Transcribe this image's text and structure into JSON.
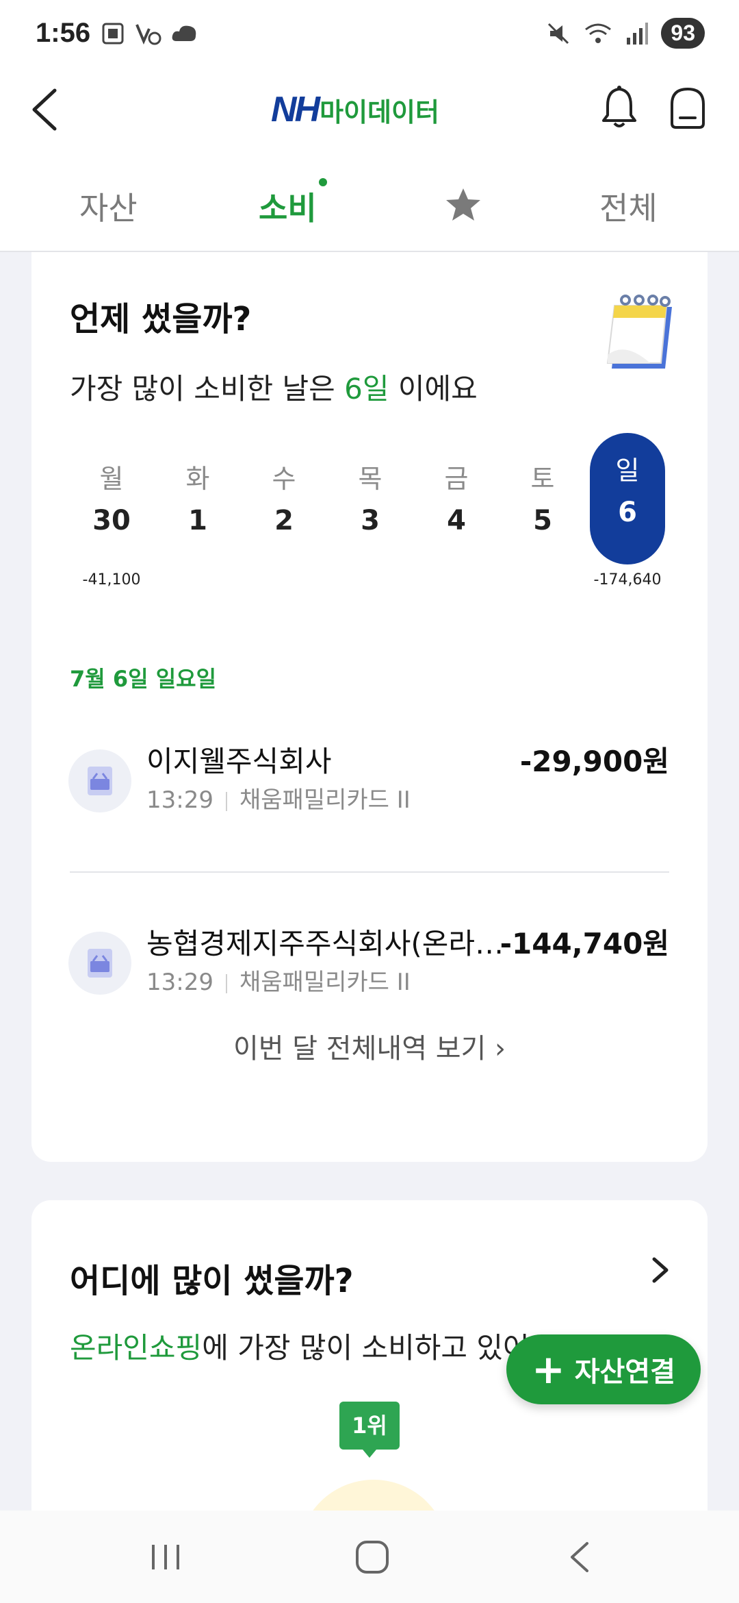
{
  "status_bar": {
    "time": "1:56",
    "battery": "93",
    "left_icons": [
      "screenshot-icon",
      "no-call-icon",
      "cloud-icon"
    ],
    "right_icons": [
      "mute-icon",
      "wifi-icon",
      "signal-icon"
    ]
  },
  "header": {
    "logo_brand": "NH",
    "logo_text": "마이데이터",
    "icons": [
      "back-icon",
      "bell-icon",
      "profile-icon"
    ]
  },
  "tabs": [
    {
      "label": "자산",
      "active": false
    },
    {
      "label": "소비",
      "active": true,
      "dot": true
    },
    {
      "label": "",
      "icon": "star-icon",
      "active": false
    },
    {
      "label": "전체",
      "active": false
    }
  ],
  "when_card": {
    "title": "언제 썼을까?",
    "subtitle_prefix": "가장 많이 소비한 날은 ",
    "subtitle_highlight": "6일",
    "subtitle_suffix": " 이에요",
    "days": [
      {
        "name": "월",
        "num": "30",
        "amount": "-41,100"
      },
      {
        "name": "화",
        "num": "1",
        "amount": ""
      },
      {
        "name": "수",
        "num": "2",
        "amount": ""
      },
      {
        "name": "목",
        "num": "3",
        "amount": ""
      },
      {
        "name": "금",
        "num": "4",
        "amount": ""
      },
      {
        "name": "토",
        "num": "5",
        "amount": ""
      },
      {
        "name": "일",
        "num": "6",
        "amount": "-174,640",
        "selected": true
      }
    ],
    "date_label": "7월 6일 일요일",
    "transactions": [
      {
        "merchant": "이지웰주식회사",
        "time": "13:29",
        "card": "채움패밀리카드 II",
        "amount": "-29,900원",
        "icon": "shopping-basket-icon"
      },
      {
        "merchant": "농협경제지주주식회사(온라…",
        "time": "13:29",
        "card": "채움패밀리카드 II",
        "amount": "-144,740원",
        "icon": "shopping-basket-icon"
      }
    ],
    "more_link": "이번 달 전체내역 보기 ›"
  },
  "where_card": {
    "title": "어디에 많이 썼을까?",
    "subtitle_highlight": "온라인쇼핑",
    "subtitle_suffix": "에 가장 많이 소비하고 있어요",
    "rank_badge": "1위"
  },
  "fab": {
    "plus": "+",
    "label": "자산연결"
  },
  "colors": {
    "accent_green": "#1f9a3c",
    "brand_blue": "#123d9b",
    "background": "#f1f2f7"
  }
}
